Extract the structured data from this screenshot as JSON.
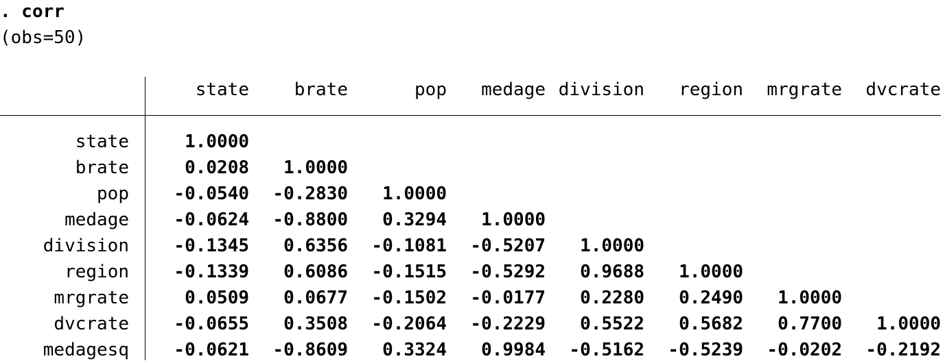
{
  "command": ". corr",
  "obs": "(obs=50)",
  "columns": [
    "state",
    "brate",
    "pop",
    "medage",
    "division",
    "region",
    "mrgrate",
    "dvcrate"
  ],
  "rows": [
    {
      "label": "state",
      "values": [
        "1.0000"
      ]
    },
    {
      "label": "brate",
      "values": [
        "0.0208",
        "1.0000"
      ]
    },
    {
      "label": "pop",
      "values": [
        "-0.0540",
        "-0.2830",
        "1.0000"
      ]
    },
    {
      "label": "medage",
      "values": [
        "-0.0624",
        "-0.8800",
        "0.3294",
        "1.0000"
      ]
    },
    {
      "label": "division",
      "values": [
        "-0.1345",
        "0.6356",
        "-0.1081",
        "-0.5207",
        "1.0000"
      ]
    },
    {
      "label": "region",
      "values": [
        "-0.1339",
        "0.6086",
        "-0.1515",
        "-0.5292",
        "0.9688",
        "1.0000"
      ]
    },
    {
      "label": "mrgrate",
      "values": [
        "0.0509",
        "0.0677",
        "-0.1502",
        "-0.0177",
        "0.2280",
        "0.2490",
        "1.0000"
      ]
    },
    {
      "label": "dvcrate",
      "values": [
        "-0.0655",
        "0.3508",
        "-0.2064",
        "-0.2229",
        "0.5522",
        "0.5682",
        "0.7700",
        "1.0000"
      ]
    },
    {
      "label": "medagesq",
      "values": [
        "-0.0621",
        "-0.8609",
        "0.3324",
        "0.9984",
        "-0.5162",
        "-0.5239",
        "-0.0202",
        "-0.2192"
      ]
    }
  ]
}
